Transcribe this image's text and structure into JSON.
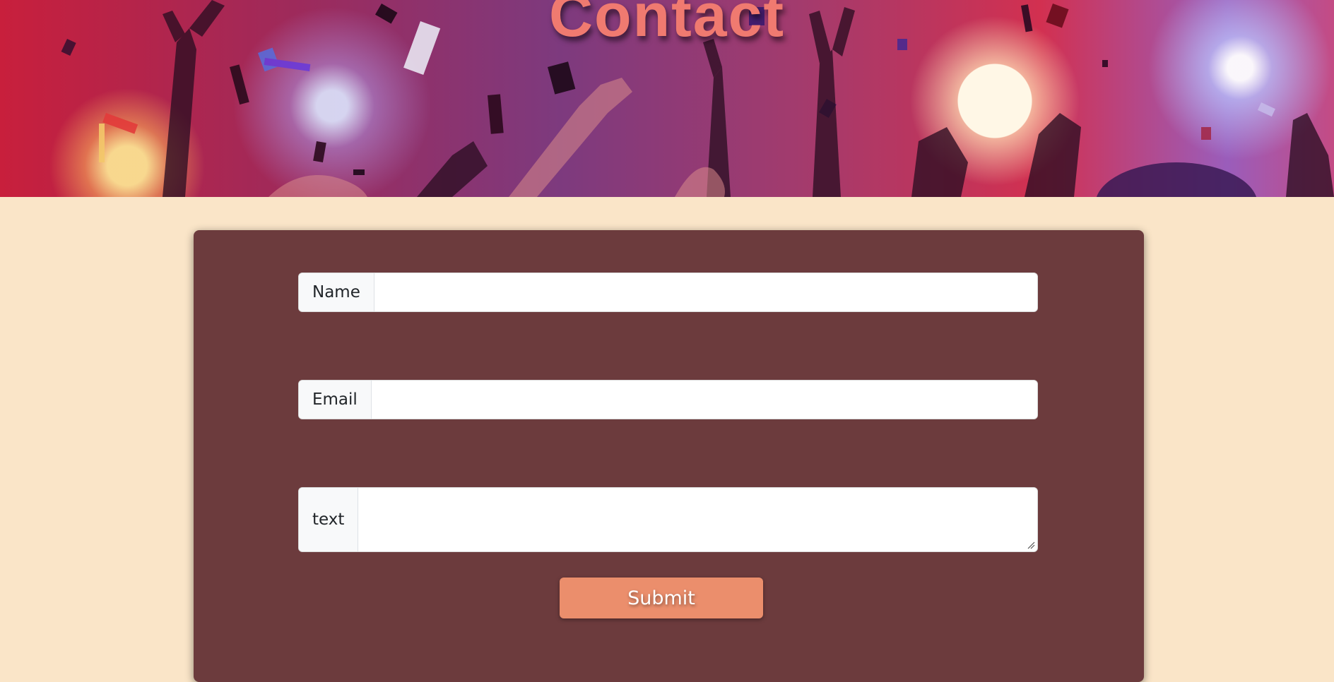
{
  "hero": {
    "title": "Contact"
  },
  "form": {
    "name_label": "Name",
    "name_value": "",
    "email_label": "Email",
    "email_value": "",
    "text_label": "text",
    "text_value": "",
    "submit_label": "Submit"
  },
  "colors": {
    "page_background": "#fae5c8",
    "card_background": "#6c3b3d",
    "title_color": "#f07a70",
    "button_background": "#eb8e6c"
  }
}
